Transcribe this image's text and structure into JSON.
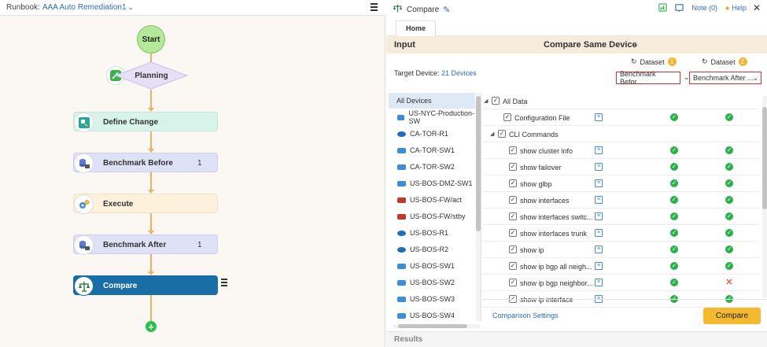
{
  "runbook": {
    "label": "Runbook:",
    "name": "AAA Auto Remediation1"
  },
  "flow": {
    "start": "Start",
    "planning": "Planning",
    "nodes": [
      {
        "name": "Define Change",
        "count": ""
      },
      {
        "name": "Benchmark Before",
        "count": "1"
      },
      {
        "name": "Execute",
        "count": ""
      },
      {
        "name": "Benchmark After",
        "count": "1"
      },
      {
        "name": "Compare",
        "count": ""
      }
    ]
  },
  "panel": {
    "title": "Compare",
    "note": "Note (0)",
    "help": "Help",
    "tab": "Home",
    "input_label": "Input",
    "mode": "Compare Same Device",
    "dataset1_header": "Dataset",
    "dataset1_badge": "1",
    "dataset2_header": "Dataset",
    "dataset2_badge": "2",
    "target_label": "Target Device:",
    "target_value": "21 Devices",
    "dataset1_value": "Benchmark Befor...",
    "dataset2_value": "Benchmark After ...",
    "compare_settings": "Comparison Settings",
    "compare_button": "Compare",
    "results": "Results"
  },
  "devices": [
    {
      "name": "All Devices",
      "type": "all"
    },
    {
      "name": "US-NYC-Production-SW",
      "type": "switch"
    },
    {
      "name": "CA-TOR-R1",
      "type": "router"
    },
    {
      "name": "CA-TOR-SW1",
      "type": "switch"
    },
    {
      "name": "CA-TOR-SW2",
      "type": "switch"
    },
    {
      "name": "US-BOS-DMZ-SW1",
      "type": "switch"
    },
    {
      "name": "US-BOS-FW/act",
      "type": "firewall"
    },
    {
      "name": "US-BOS-FW/stby",
      "type": "firewall"
    },
    {
      "name": "US-BOS-R1",
      "type": "router"
    },
    {
      "name": "US-BOS-R2",
      "type": "router"
    },
    {
      "name": "US-BOS-SW1",
      "type": "switch"
    },
    {
      "name": "US-BOS-SW2",
      "type": "switch"
    },
    {
      "name": "US-BOS-SW3",
      "type": "switch"
    },
    {
      "name": "US-BOS-SW4",
      "type": "switch"
    }
  ],
  "tree": [
    {
      "label": "All Data",
      "level": 0,
      "toggle": true,
      "info": false,
      "r1": "",
      "r2": ""
    },
    {
      "label": "Configuration File",
      "level": 1,
      "toggle": false,
      "info": true,
      "r1": "ok",
      "r2": "ok"
    },
    {
      "label": "CLI Commands",
      "level": 1,
      "toggle": true,
      "info": false,
      "r1": "",
      "r2": ""
    },
    {
      "label": "show cluster info",
      "level": 2,
      "toggle": false,
      "info": true,
      "r1": "ok",
      "r2": "ok"
    },
    {
      "label": "show failover",
      "level": 2,
      "toggle": false,
      "info": true,
      "r1": "ok",
      "r2": "ok"
    },
    {
      "label": "show glbp",
      "level": 2,
      "toggle": false,
      "info": true,
      "r1": "ok",
      "r2": "ok"
    },
    {
      "label": "show interfaces",
      "level": 2,
      "toggle": false,
      "info": true,
      "r1": "ok",
      "r2": "ok"
    },
    {
      "label": "show interfaces switc...",
      "level": 2,
      "toggle": false,
      "info": true,
      "r1": "ok",
      "r2": "ok"
    },
    {
      "label": "show interfaces trunk",
      "level": 2,
      "toggle": false,
      "info": true,
      "r1": "ok",
      "r2": "ok"
    },
    {
      "label": "show ip",
      "level": 2,
      "toggle": false,
      "info": true,
      "r1": "ok",
      "r2": "ok"
    },
    {
      "label": "show ip bgp all neigh...",
      "level": 2,
      "toggle": false,
      "info": true,
      "r1": "ok",
      "r2": "ok"
    },
    {
      "label": "show ip bgp neighbor...",
      "level": 2,
      "toggle": false,
      "info": true,
      "r1": "ok",
      "r2": "fail"
    },
    {
      "label": "show ip interface",
      "level": 2,
      "toggle": false,
      "info": true,
      "r1": "ok",
      "r2": "ok"
    }
  ],
  "colors": {
    "accent": "#2d6db5",
    "compare_node": "#1a6ea8",
    "compare_button": "#f5b930",
    "ok": "#2bb04a",
    "fail": "#e8614a"
  }
}
